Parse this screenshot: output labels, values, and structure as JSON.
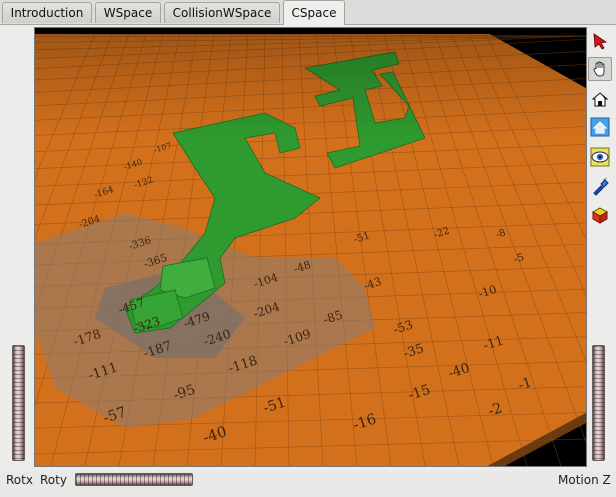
{
  "tabs": [
    {
      "label": "Introduction"
    },
    {
      "label": "WSpace"
    },
    {
      "label": "CollisionWSpace"
    },
    {
      "label": "CSpace",
      "active": true
    }
  ],
  "toolbar": {
    "tools": [
      {
        "icon": "select-arrow-icon",
        "pressed": false
      },
      {
        "icon": "pan-hand-icon",
        "pressed": true
      },
      {
        "icon": "view-home-icon",
        "pressed": false
      },
      {
        "icon": "set-home-icon",
        "pressed": false
      },
      {
        "icon": "view-all-eye-icon",
        "pressed": false
      },
      {
        "icon": "seek-flashlight-icon",
        "pressed": false
      },
      {
        "icon": "perspective-cube-icon",
        "pressed": false
      }
    ]
  },
  "bottom": {
    "rotx_label": "Rotx",
    "roty_label": "Roty",
    "motion_label": "Motion Z"
  },
  "scene": {
    "colors": {
      "free": "#d3701c",
      "obstacle": "#2f9a2f",
      "background": "#000000"
    },
    "cell_values": [
      "-40",
      "-57",
      "-95",
      "-111",
      "-118",
      "-16",
      "-51",
      "-187",
      "-178",
      "-240",
      "-323",
      "-479",
      "-457",
      "-365",
      "-204",
      "-109",
      "-85",
      "-53",
      "-35",
      "-43",
      "-40",
      "-15",
      "-11",
      "-10",
      "-5",
      "-8",
      "-2",
      "-1",
      "-336",
      "-204",
      "-164",
      "-140",
      "-107",
      "-122",
      "-48",
      "-51",
      "-22",
      "-104"
    ]
  }
}
